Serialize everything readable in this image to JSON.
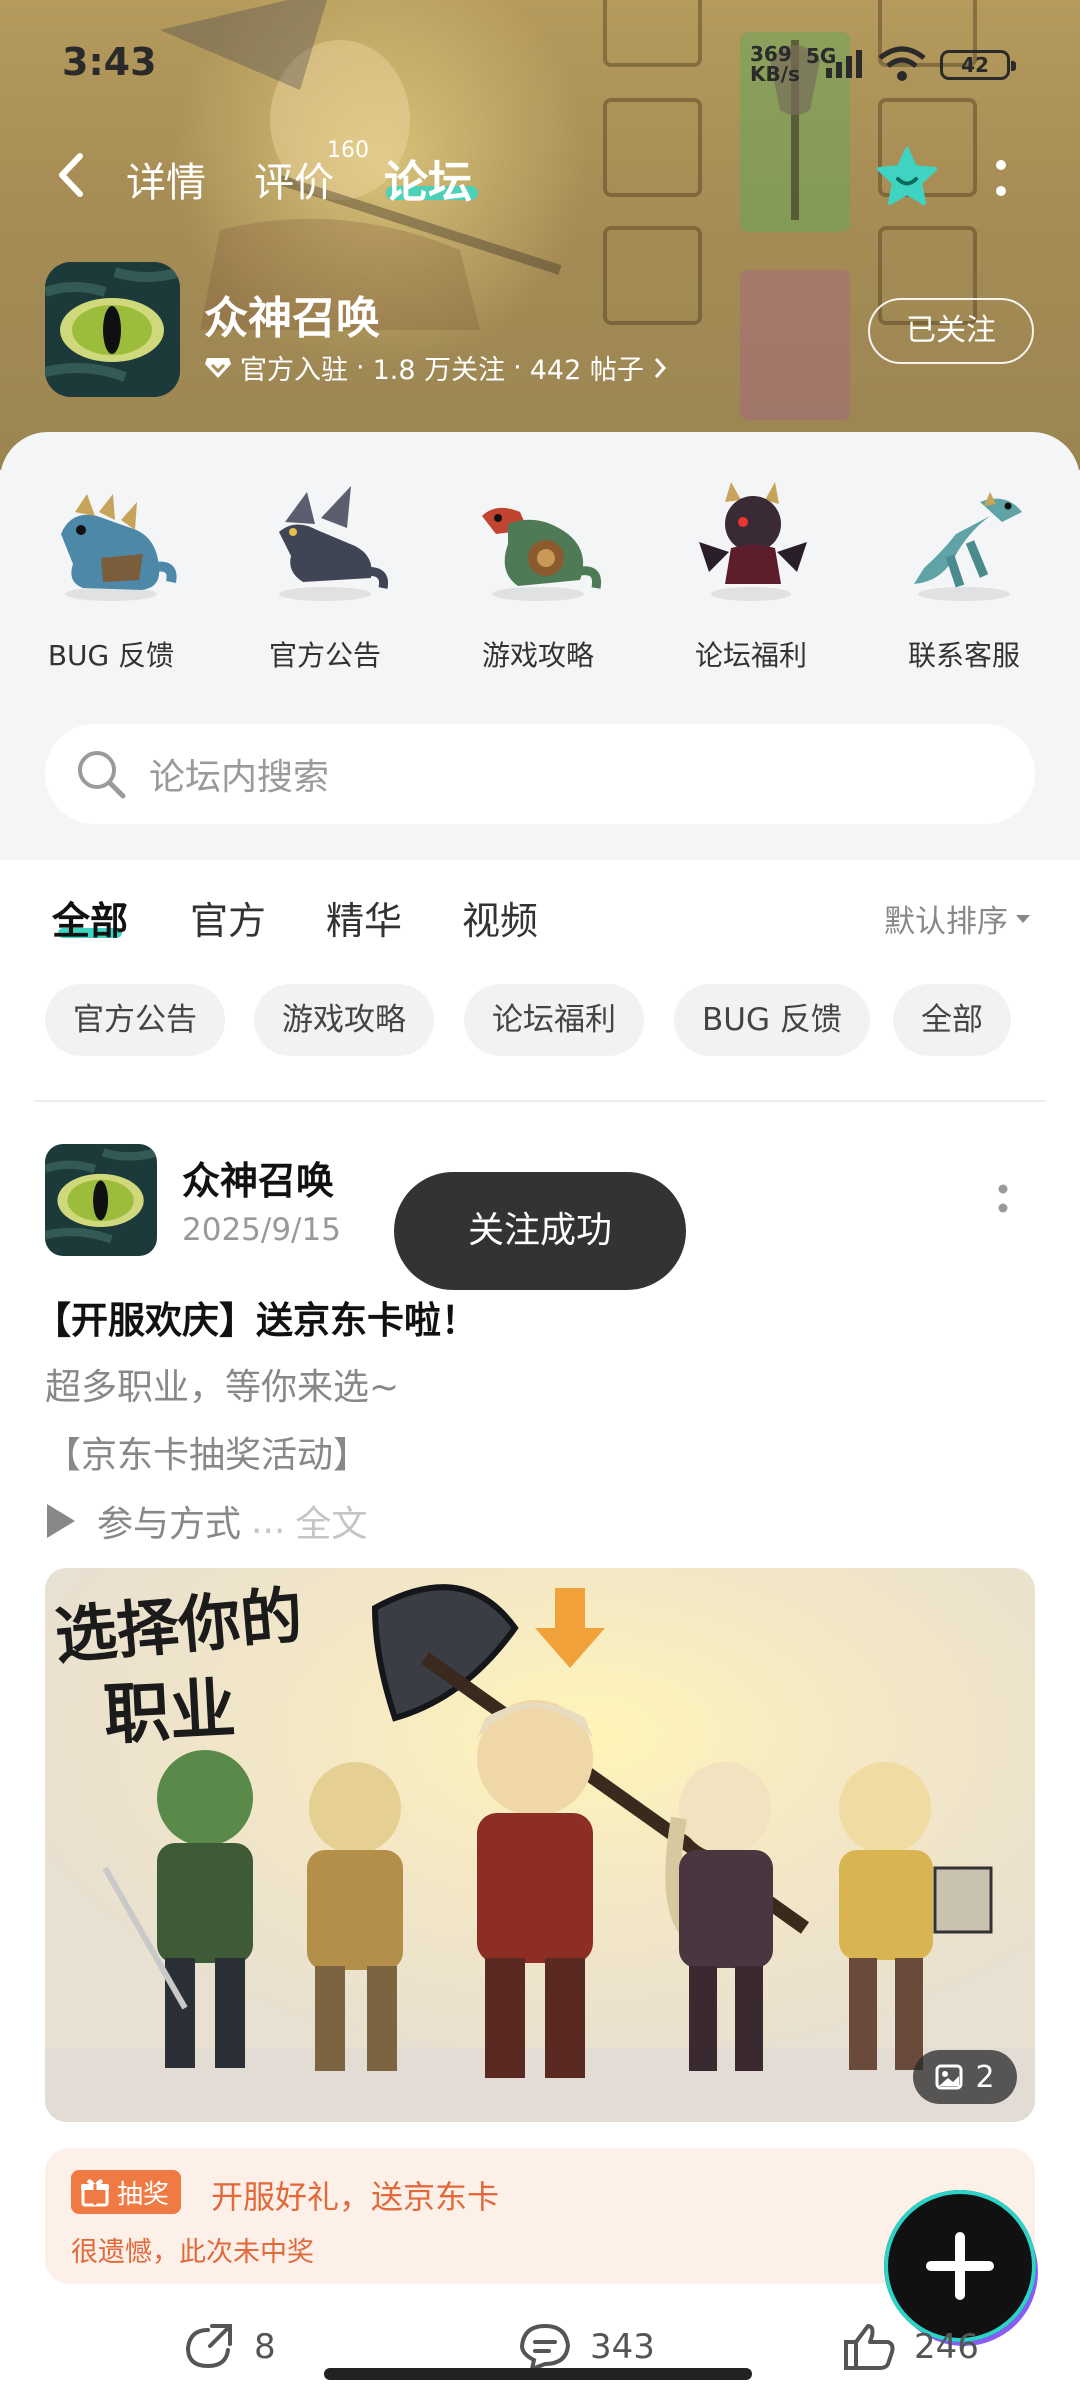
{
  "status_bar": {
    "time": "3:43",
    "network_speed_top": "369",
    "network_speed_bottom": "KB/s",
    "network_type": "5G",
    "battery": "42"
  },
  "nav": {
    "tabs": [
      {
        "label": "详情"
      },
      {
        "label": "评价",
        "badge": "160"
      },
      {
        "label": "论坛"
      }
    ],
    "accent_color": "#3fd4c1"
  },
  "app": {
    "title": "众神召唤",
    "verified_label": "官方入驻",
    "followers": "1.8 万关注",
    "posts": "442 帖子",
    "follow_button": "已关注"
  },
  "sections": [
    {
      "label": "BUG 反馈",
      "icon": "dragon-icon"
    },
    {
      "label": "官方公告",
      "icon": "dragon-icon"
    },
    {
      "label": "游戏攻略",
      "icon": "dragon-icon"
    },
    {
      "label": "论坛福利",
      "icon": "dragon-icon"
    },
    {
      "label": "联系客服",
      "icon": "dragon-icon"
    }
  ],
  "search": {
    "placeholder": "论坛内搜索"
  },
  "filter_tabs": [
    "全部",
    "官方",
    "精华",
    "视频"
  ],
  "sort_label": "默认排序",
  "chips": [
    "官方公告",
    "游戏攻略",
    "论坛福利",
    "BUG 反馈",
    "全部"
  ],
  "post": {
    "author": "众神召唤",
    "date": "2025/9/15",
    "title": "【开服欢庆】送京东卡啦！",
    "lines": [
      "超多职业，等你来选~",
      "【京东卡抽奖活动】"
    ],
    "line3": "参与方式",
    "ellipsis": "...",
    "full_text": "全文",
    "image_caption_line1": "选择你的",
    "image_caption_line2": "职业",
    "image_count": "2",
    "lottery": {
      "tag": "抽奖",
      "title": "开服好礼，送京东卡",
      "result": "很遗憾，此次未中奖"
    },
    "actions": {
      "shares": "8",
      "comments": "343",
      "likes": "246"
    }
  },
  "toast": "关注成功"
}
